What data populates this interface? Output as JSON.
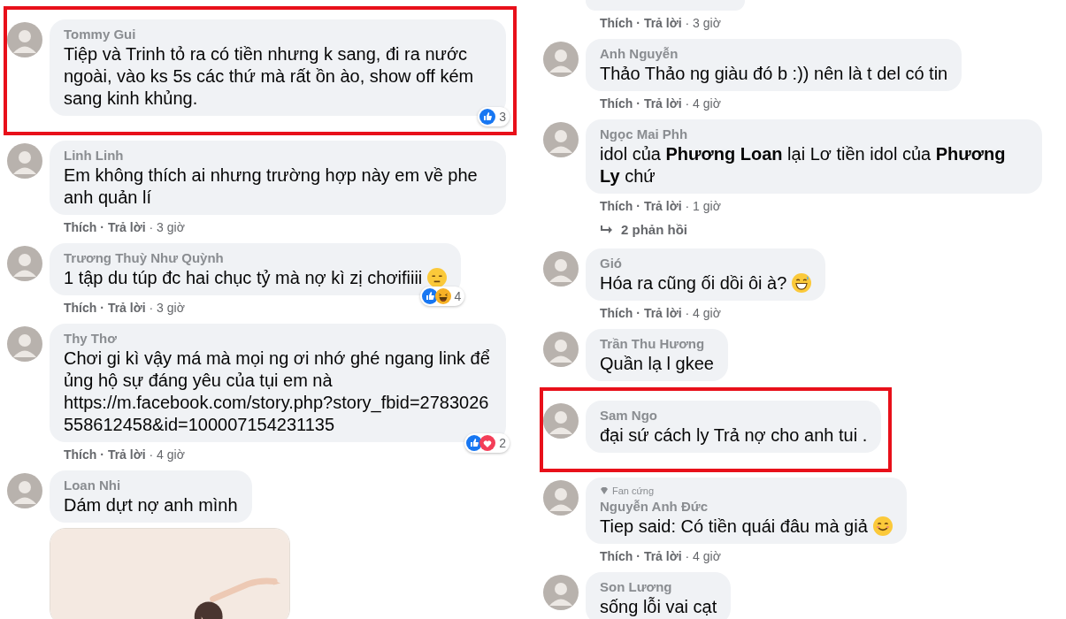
{
  "left_column": [
    {
      "author": "Tommy Gui",
      "text": "Tiệp và Trinh tỏ ra có tiền nhưng k sang, đi ra nước ngoài, vào ks 5s các thứ mà rất ồn ào, show off kém sang kinh khủng.",
      "highlighted": true,
      "reactions": {
        "icons": [
          {
            "kind": "like"
          }
        ],
        "count": "3"
      }
    },
    {
      "author": "Linh Linh",
      "text": "Em không thích ai nhưng trường hợp này em về phe anh quản lí",
      "meta": {
        "like": "Thích",
        "reply": "· Trả lời",
        "time": "· 3 giờ"
      }
    },
    {
      "author": "Trương Thuỳ Như Quỳnh",
      "text": "1 tập du túp đc hai chục tỷ mà nợ kì zị chơifiiii",
      "emoji": {
        "kind": "sad"
      },
      "reactions": {
        "icons": [
          {
            "kind": "like"
          },
          {
            "kind": "haha"
          }
        ],
        "count": "4"
      },
      "meta": {
        "like": "Thích",
        "reply": "· Trả lời",
        "time": "· 3 giờ"
      }
    },
    {
      "author": "Thy Thơ",
      "text": "Chơi gi kì vậy má mà mọi ng ơi nhớ ghé ngang link để ủng hộ sự đáng yêu của tụi em nà",
      "link": "https://m.facebook.com/story.php?story_fbid=2783026558612458&id=100007154231135",
      "reactions": {
        "icons": [
          {
            "kind": "like"
          },
          {
            "kind": "love"
          }
        ],
        "count": "2"
      },
      "meta": {
        "like": "Thích",
        "reply": "· Trả lời",
        "time": "· 4 giờ"
      }
    },
    {
      "author": "Loan Nhi",
      "text": "Dám dựt nợ anh mình"
    }
  ],
  "right_column": [
    {
      "kind": "cut",
      "meta": {
        "like": "Thích",
        "reply": "· Trả lời",
        "time": "· 3 giờ"
      }
    },
    {
      "author": "Anh Nguyễn",
      "text": "Thảo Thảo ng giàu đó b :)) nên là t del có tin",
      "meta": {
        "like": "Thích",
        "reply": "· Trả lời",
        "time": "· 4 giờ"
      }
    },
    {
      "author": "Ngọc Mai Phh",
      "text": "idol của **Phương Loan** lại Lơ tiền idol của **Phương Ly** chứ",
      "meta": {
        "like": "Thích",
        "reply": "· Trả lời",
        "time": "· 1 giờ"
      },
      "replies": "2 phản hồi"
    },
    {
      "author": "Gió",
      "text": "Hóa ra cũng ối dồi ôi à?",
      "emoji": {
        "kind": "grin"
      },
      "meta": {
        "like": "Thích",
        "reply": "· Trả lời",
        "time": "· 4 giờ"
      }
    },
    {
      "author": "Trần Thu Hương",
      "text": "Quần lạ l gkee"
    },
    {
      "author": "Sam Ngo",
      "text": "đại sứ cách ly Trả nợ cho anh tui .",
      "highlighted": true
    },
    {
      "author": "Nguyễn Anh Đức",
      "badge": "Fan cứng",
      "text": "Tiep said: Có tiền quái đâu mà giả",
      "emoji": {
        "kind": "smile"
      },
      "meta": {
        "like": "Thích",
        "reply": "· Trả lời",
        "time": "· 4 giờ"
      }
    },
    {
      "author": "Son Lương",
      "text": "sống lỗi vai cạt"
    }
  ]
}
